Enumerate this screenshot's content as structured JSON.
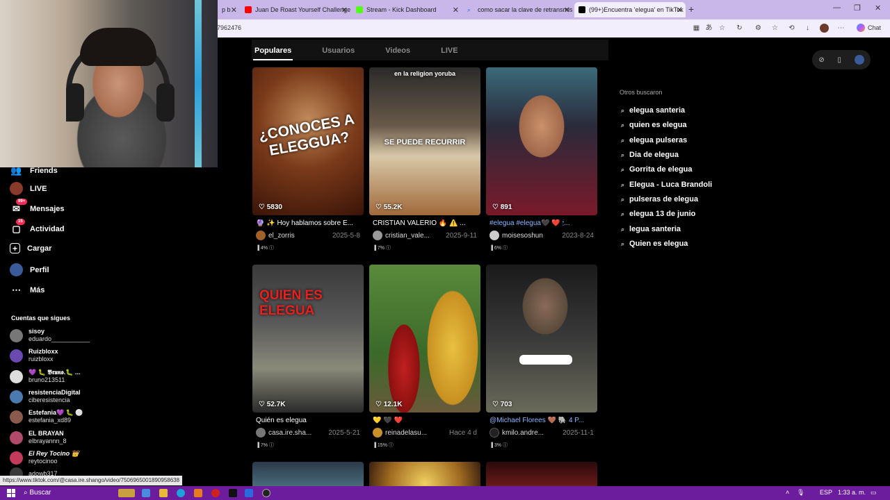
{
  "browser": {
    "tabs": [
      {
        "label": "p b",
        "fav_color": "#444444"
      },
      {
        "label": "Juan De Roast Yourself Challenge",
        "fav_color": "#ff0000"
      },
      {
        "label": "Stream - Kick Dashboard",
        "fav_color": "#53fc18"
      },
      {
        "label": "como sacar la clave de retransmisi",
        "fav_color": "#2b6cff"
      },
      {
        "label": "(99+)Encuentra 'elegua' en TikTok",
        "fav_color": "#000000"
      }
    ],
    "new_tab": "+",
    "address_fragment": "7962476",
    "copilot_label": "Chat",
    "window_controls": {
      "minimize": "—",
      "maximize": "❐",
      "close": "✕"
    }
  },
  "sidebar": {
    "items": [
      {
        "label": "Friends",
        "icon": "friends-icon",
        "badge": ""
      },
      {
        "label": "LIVE",
        "icon": "live-icon",
        "badge": ""
      },
      {
        "label": "Mensajes",
        "icon": "messages-icon",
        "badge": "99+"
      },
      {
        "label": "Actividad",
        "icon": "activity-icon",
        "badge": "15"
      },
      {
        "label": "Cargar",
        "icon": "upload-icon",
        "badge": ""
      },
      {
        "label": "Perfil",
        "icon": "profile-icon",
        "badge": ""
      },
      {
        "label": "Más",
        "icon": "more-icon",
        "badge": ""
      }
    ],
    "following_title": "Cuentas que sigues",
    "following": [
      {
        "name": "sisoy",
        "handle": "eduardo___________"
      },
      {
        "name": "Ruizbloxx",
        "handle": "ruizbloxx"
      },
      {
        "name": "💜 🐛 𝕭𝖗𝖚𝖓𝖔.🐛 ...",
        "handle": "bruno213511"
      },
      {
        "name": "resistenciaDigital",
        "handle": "ciberesistencia"
      },
      {
        "name": "Estefania💜 🐛 ⚪",
        "handle": "estefania_xd89"
      },
      {
        "name": "EL BRAYAN",
        "handle": "elbrayannn_8"
      },
      {
        "name": "El Rey Tocino 👑",
        "handle": "reytocinoo"
      },
      {
        "name": "",
        "handle": "adowb317"
      }
    ]
  },
  "search_tabs": [
    "Populares",
    "Usuarios",
    "Videos",
    "LIVE"
  ],
  "videos": [
    {
      "likes": "5830",
      "desc": "🔮 ✨ Hoy hablamos sobre E...",
      "user": "el_zorris",
      "date": "2025-5-8",
      "stat": "4%",
      "overlay": "¿CONOCES A ELEGGUA?",
      "blue": false
    },
    {
      "likes": "55.2K",
      "desc": "CRISTIAN VALERIO 🔥 ⚠️ ...",
      "user": "cristian_vale...",
      "date": "2025-9-11",
      "stat": "7%",
      "overlay": "SE PUEDE RECURRIR",
      "overlay_top": "en la religion yoruba",
      "blue": false
    },
    {
      "likes": "891",
      "desc": "#elegua #elegua🖤 ❤️ 🕯...",
      "user": "moisesoshun",
      "date": "2023-8-24",
      "stat": "6%",
      "overlay": "",
      "blue": true
    },
    {
      "likes": "52.7K",
      "desc": "Quién es elegua",
      "user": "casa.ire.sha...",
      "date": "2025-5-21",
      "stat": "7%",
      "overlay": "QUIEN ES ELEGUA",
      "blue": false
    },
    {
      "likes": "12.1K",
      "desc": "💛 🖤 ❤️",
      "user": "reinadelasu...",
      "date": "Hace 4 d",
      "stat": "15%",
      "overlay": "",
      "blue": false
    },
    {
      "likes": "703",
      "desc": "@Michael Florees 🤎 🐘 4 P...",
      "user": "kmilo.andre...",
      "date": "2025-11-1",
      "stat": "3%",
      "overlay": "",
      "blue": true
    }
  ],
  "others": {
    "title": "Otros buscaron",
    "items": [
      "elegua santeria",
      "quien es elegua",
      "elegua pulseras",
      "Dia de elegua",
      "Gorrita de elegua",
      "Elegua - Luca Brandoli",
      "pulseras de elegua",
      "elegua 13 de junio",
      "legua santeria",
      "Quien es elegua"
    ]
  },
  "status_url": "https://www.tiktok.com/@casa.ire.shango/video/7506965001890958638",
  "taskbar": {
    "search": "Buscar",
    "lang": "ESP",
    "time": "1:33 a. m."
  }
}
